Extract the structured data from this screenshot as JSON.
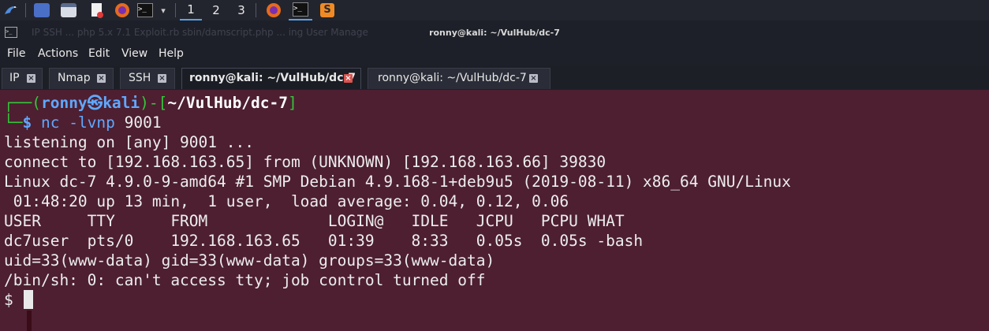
{
  "taskbar": {
    "icons": [
      "kali-dragon-icon",
      "desktop-icon",
      "files-icon",
      "text-editor-icon",
      "firefox-icon",
      "terminal-icon",
      "dropdown-icon"
    ],
    "workspaces": [
      "1",
      "2",
      "3"
    ],
    "apps": [
      "firefox-icon",
      "terminal-icon",
      "sublime-icon"
    ]
  },
  "window": {
    "title": "ronny@kali: ~/VulHub/dc-7",
    "ghost_text": "IP    SSH    ...    php 5.x 7.1 Exploit.rb      sbin/damscript.php      ...      ing User Manage"
  },
  "menu": [
    "File",
    "Actions",
    "Edit",
    "View",
    "Help"
  ],
  "tabs": [
    {
      "label": "IP"
    },
    {
      "label": "Nmap"
    },
    {
      "label": "SSH"
    },
    {
      "label": "ronny@kali: ~/VulHub/dc-7"
    },
    {
      "label": "ronny@kali: ~/VulHub/dc-7"
    }
  ],
  "terminal": {
    "prompt": {
      "open": "┌──(",
      "user": "ronny",
      "at": "㉿",
      "host": "kali",
      "mid": ")-[",
      "path": "~/VulHub/dc-7",
      "close": "]",
      "line2": "└─",
      "dollar": "$",
      "cmd": "nc -lvnp",
      "arg": "9001"
    },
    "lines": [
      "listening on [any] 9001 ...",
      "connect to [192.168.163.65] from (UNKNOWN) [192.168.163.66] 39830",
      "Linux dc-7 4.9.0-9-amd64 #1 SMP Debian 4.9.168-1+deb9u5 (2019-08-11) x86_64 GNU/Linux",
      " 01:48:20 up 13 min,  1 user,  load average: 0.04, 0.12, 0.06",
      "USER     TTY      FROM             LOGIN@   IDLE   JCPU   PCPU WHAT",
      "dc7user  pts/0    192.168.163.65   01:39    8:33   0.05s  0.05s -bash",
      "uid=33(www-data) gid=33(www-data) groups=33(www-data)",
      "/bin/sh: 0: can't access tty; job control turned off",
      "$ "
    ]
  },
  "colors": {
    "terminal_bg": "#4d1f31",
    "prompt_green": "#36c53a",
    "prompt_blue": "#5fa8ff"
  }
}
